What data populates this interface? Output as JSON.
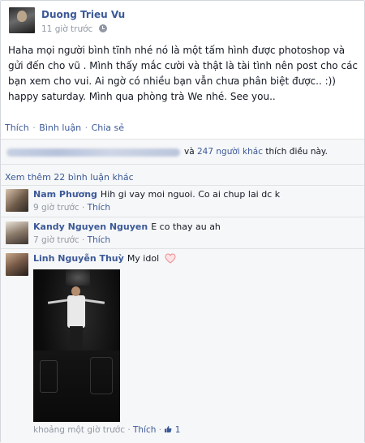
{
  "post": {
    "author": "Duong Trieu Vu",
    "time": "11 giờ trước",
    "privacy_icon": "clock-icon",
    "text": "Haha mọi người bình tĩnh nhé nó là một tấm hình được photoshop và gửi đến cho vũ . Mình thấy mắc cười và thật là tài tình nên post cho các bạn xem cho vui. Ai ngờ có nhiều bạn vẫn chưa phân biệt được.. :)) happy saturday. Mình qua phòng trà We nhé. See you..",
    "actions": {
      "like": "Thích",
      "comment": "Bình luận",
      "share": "Chia sẻ",
      "separator": "·"
    }
  },
  "likes": {
    "prefix": "và",
    "others": "247 người khác",
    "suffix": "thích điều này."
  },
  "more_comments": "Xem thêm 22 bình luận khác",
  "comments": [
    {
      "name": "Nam Phương",
      "text": "Hih gi vay moi nguoi. Co ai chup lai dc k",
      "time": "9 giờ trước",
      "like": "Thích"
    },
    {
      "name": "Kandy Nguyen Nguyen",
      "text": "E co thay au ah",
      "time": "7 giờ trước",
      "like": "Thích"
    },
    {
      "name": "Linh Nguyễn Thuỳ",
      "text": "My idol",
      "time": "khoảng một giờ trước",
      "like": "Thích",
      "like_count": "1"
    }
  ],
  "colors": {
    "link": "#3b5998",
    "meta": "#9197a3",
    "ufi_background": "#f6f7f8",
    "heart": "#f4b6b8"
  }
}
